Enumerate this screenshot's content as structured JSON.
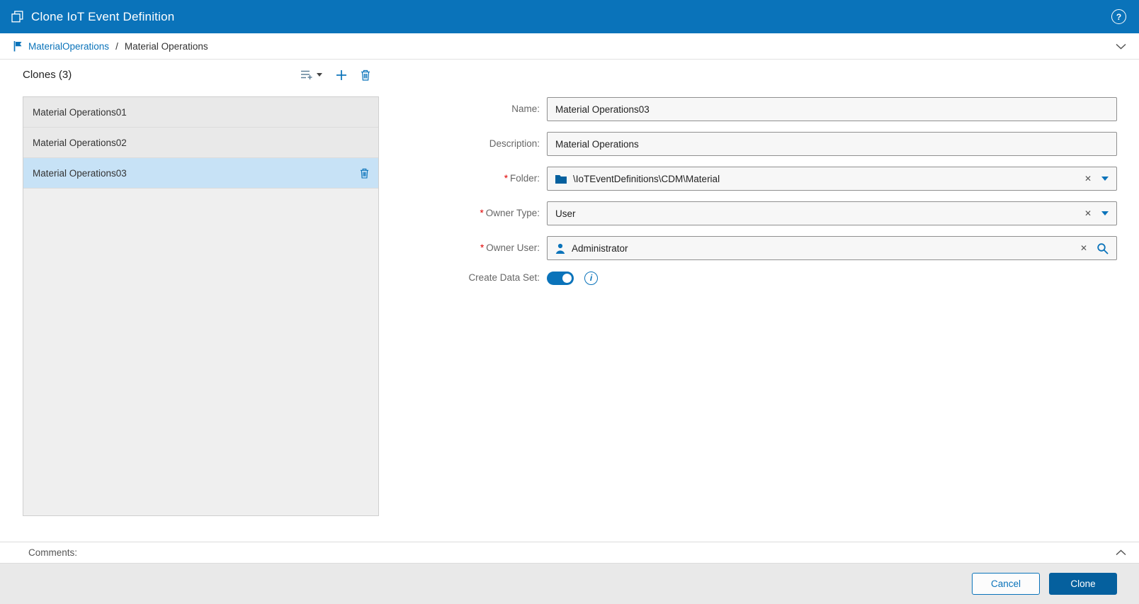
{
  "titlebar": {
    "title": "Clone IoT Event Definition"
  },
  "breadcrumb": {
    "root": "MaterialOperations",
    "separator": "/",
    "current": "Material Operations"
  },
  "clones": {
    "heading": "Clones (3)",
    "items": [
      {
        "label": "Material Operations01"
      },
      {
        "label": "Material Operations02"
      },
      {
        "label": "Material Operations03"
      }
    ],
    "selected_index": 2
  },
  "form": {
    "required_marker": "*",
    "name": {
      "label": "Name:",
      "value": "Material Operations03"
    },
    "description": {
      "label": "Description:",
      "value": "Material Operations"
    },
    "folder": {
      "label": "Folder:",
      "value": "\\IoTEventDefinitions\\CDM\\Material",
      "required": true
    },
    "owner_type": {
      "label": "Owner Type:",
      "value": "User",
      "required": true
    },
    "owner_user": {
      "label": "Owner User:",
      "value": "Administrator",
      "required": true
    },
    "create_data_set": {
      "label": "Create Data Set:",
      "enabled": true
    }
  },
  "comments": {
    "label": "Comments:"
  },
  "footer": {
    "cancel": "Cancel",
    "clone": "Clone"
  },
  "icons": {
    "help": "?",
    "info": "i",
    "clear": "✕"
  },
  "colors": {
    "titlebar": "#0a73ba",
    "accent": "#0a73ba",
    "selected_item": "#c7e2f6",
    "primary_button": "#05609e",
    "required": "#e00000"
  }
}
